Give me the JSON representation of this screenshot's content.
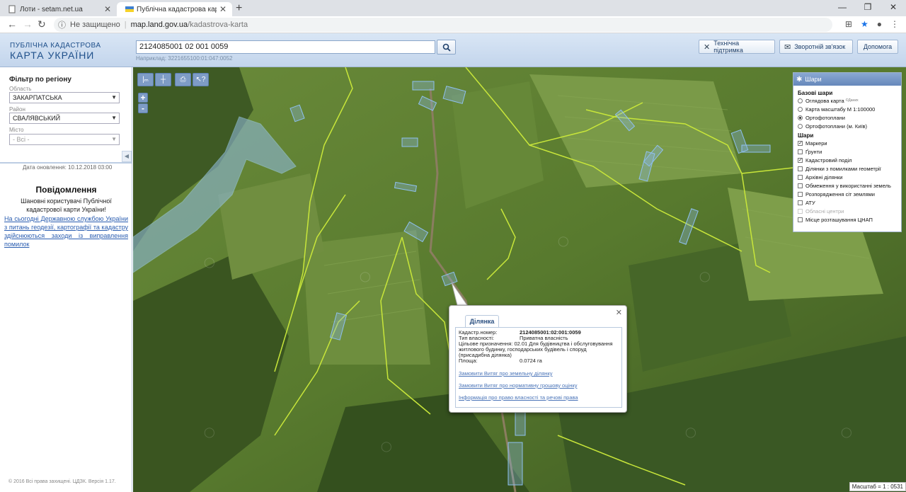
{
  "browser": {
    "tabs": [
      {
        "title": "Лоти - setam.net.ua"
      },
      {
        "title": "Публічна кадастрова карта Укр"
      }
    ],
    "security_label": "Не защищено",
    "url_domain": "map.land.gov.ua",
    "url_path": "/kadastrova-karta"
  },
  "header": {
    "logo_line1": "ПУБЛІЧНА КАДАСТРОВА",
    "logo_line2": "КАРТА УКРАЇНИ",
    "search_value": "2124085001 02 001 0059",
    "search_hint": "Наприклад: 3221655100:01:047:0052",
    "buttons": {
      "support": "Технічна підтримка",
      "feedback": "Зворотній зв'язок",
      "help": "Допомога"
    }
  },
  "sidebar": {
    "filter_title": "Фільтр по регіону",
    "region_label": "Область",
    "region_value": "ЗАКАРПАТСЬКА",
    "district_label": "Район",
    "district_value": "СВАЛЯВСЬКИЙ",
    "city_label": "Місто",
    "city_value": "- Всі -",
    "update_date": "Дата оновлення: 10.12.2018 03:00",
    "notice_title": "Повідомлення",
    "notice_text": "Шановні користувачі Публічної кадастрової карти України!",
    "notice_link": "На сьогодні Державною службою України з питань геодезії, картографії та кадастру здійснюються заходи із виправлення помилок",
    "copyright": "© 2016 Всі права захищені. ЦДЗК. Версія 1.17."
  },
  "map": {
    "zoom_in": "+",
    "zoom_out": "-",
    "scale": "Масштаб = 1 : 0531"
  },
  "layers": {
    "title": "Шари",
    "base_group": "Базові шари",
    "base_layers": [
      {
        "label": "Оглядова карта",
        "note": "©Даних",
        "selected": false
      },
      {
        "label": "Карта масштабу М 1:100000",
        "selected": false
      },
      {
        "label": "Ортофотоплани",
        "selected": true
      },
      {
        "label": "Ортофотоплани (м. Київ)",
        "selected": false
      }
    ],
    "overlay_group": "Шари",
    "overlays": [
      {
        "label": "Маркери",
        "checked": true,
        "disabled": false
      },
      {
        "label": "Ґрунти",
        "checked": false,
        "disabled": false
      },
      {
        "label": "Кадастровий поділ",
        "checked": true,
        "disabled": false
      },
      {
        "label": "Ділянки з помилками геометрії",
        "checked": false,
        "disabled": false
      },
      {
        "label": "Архівні ділянки",
        "checked": false,
        "disabled": false
      },
      {
        "label": "Обмеження у використанні земель",
        "checked": false,
        "disabled": false
      },
      {
        "label": "Розпорядження сіт землями",
        "checked": false,
        "disabled": false
      },
      {
        "label": "АТУ",
        "checked": false,
        "disabled": false
      },
      {
        "label": "Обласні центри",
        "checked": false,
        "disabled": true
      },
      {
        "label": "Місце розташування ЦНАП",
        "checked": false,
        "disabled": false
      }
    ]
  },
  "popup": {
    "tab": "Ділянка",
    "cadastral_label": "Кадастр.номер:",
    "cadastral_value": "2124085001:02:001:0059",
    "ownership_label": "Тип власності:",
    "ownership_value": "Приватна власність",
    "purpose_label": "Цільове призначення:",
    "purpose_value": "02.01 Для будівництва і обслуговування житлового будинку, господарських будівель і споруд (присадибна ділянка)",
    "area_label": "Площа:",
    "area_value": "0.0724 га",
    "links": [
      "Замовити Витяг про земельну ділянку",
      "Замовити Витяг про нормативну грошову оцінку",
      "Інформація про право власності та речові права"
    ]
  }
}
